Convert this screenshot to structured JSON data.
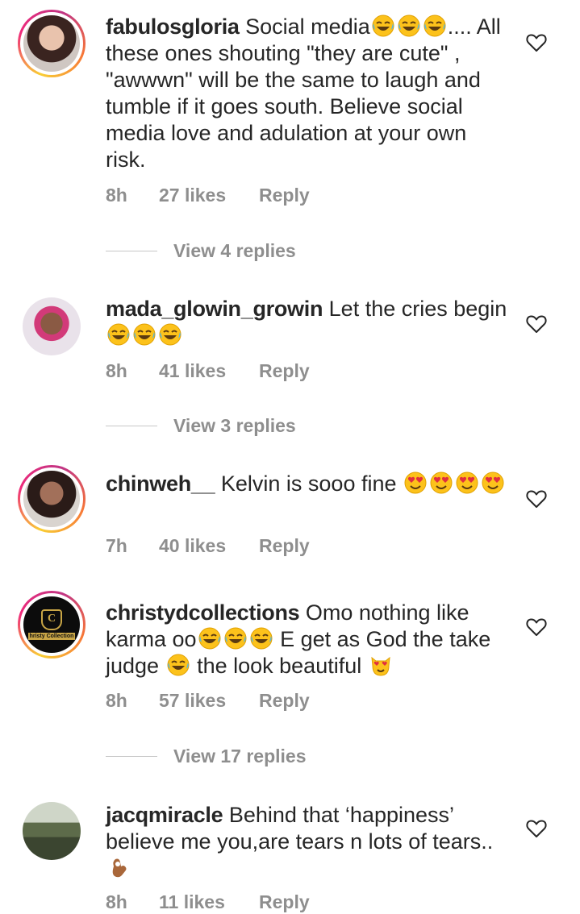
{
  "comments": [
    {
      "username": "fabulosgloria",
      "text_before": "Social media",
      "text_emojis": "😂😂😂",
      "text_after": "....",
      "text_rest": "All these ones shouting \"they are cute\" , \"awwwn\" will be the same to laugh and tumble if it goes south. Believe social media love and adulation at your own risk.",
      "time": "8h",
      "likes": "27 likes",
      "reply": "Reply",
      "view_replies": "View 4 replies"
    },
    {
      "username": "mada_glowin_growin",
      "text_before": "Let the cries begin ",
      "text_emojis": "😂😂😂",
      "time": "8h",
      "likes": "41 likes",
      "reply": "Reply",
      "view_replies": "View 3 replies"
    },
    {
      "username": "chinweh__",
      "text_before": "Kelvin is sooo fine ",
      "text_emojis": "😍😍😍😍",
      "time": "7h",
      "likes": "40 likes",
      "reply": "Reply"
    },
    {
      "username": "christydcollections",
      "text_before": "Omo nothing like karma oo",
      "text_emojis": "😂😂😂",
      "text_after": " E get as God the take judge ",
      "text_emojis2": "😂",
      "text_after2": " the look beautiful ",
      "text_emojis3": "😻",
      "avatar_text": "hristy Collection",
      "time": "8h",
      "likes": "57 likes",
      "reply": "Reply",
      "view_replies": "View 17 replies"
    },
    {
      "username": "jacqmiracle",
      "text_before": "Behind that ‘happiness’ believe me you,are tears n lots of tears..",
      "text_emojis": "👌🏾",
      "time": "8h",
      "likes": "11 likes",
      "reply": "Reply"
    }
  ],
  "icons": {
    "like": "heart-outline-icon",
    "laugh": "face-with-tears-of-joy-emoji",
    "love": "heart-eyes-emoji",
    "cat": "heart-eyes-cat-emoji",
    "ok": "ok-hand-emoji"
  },
  "colors": {
    "text": "#262626",
    "meta": "#8e8e8e"
  }
}
